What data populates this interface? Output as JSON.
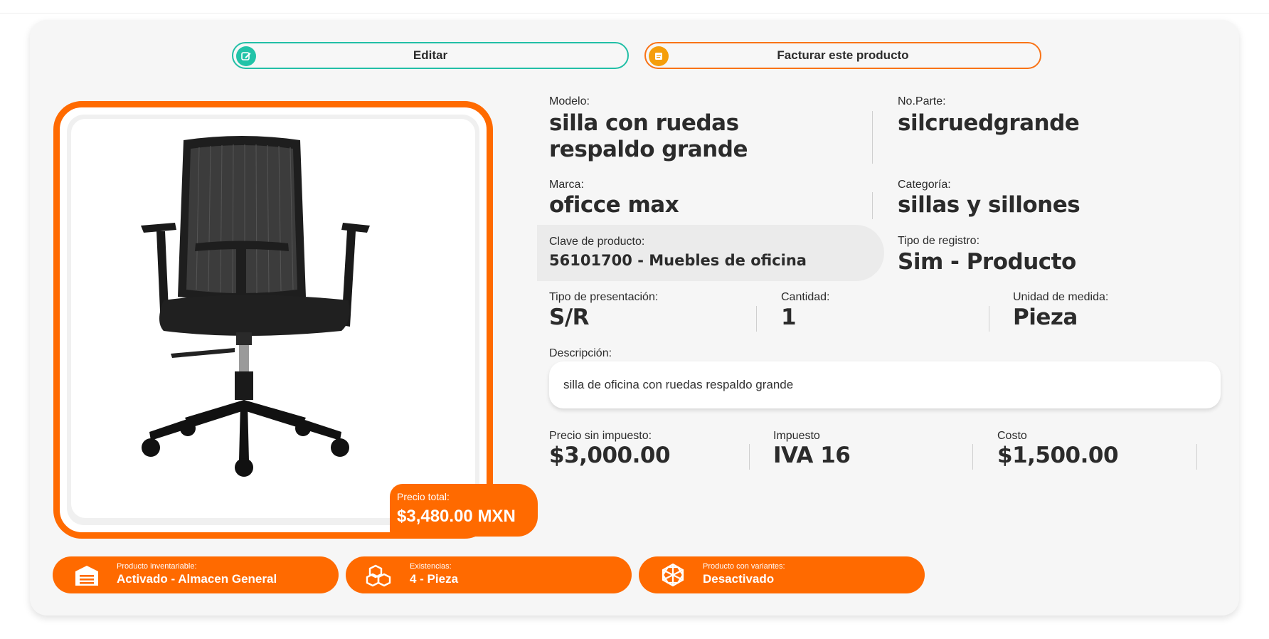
{
  "actions": {
    "edit_label": "Editar",
    "invoice_label": "Facturar este producto"
  },
  "product": {
    "modelo_label": "Modelo:",
    "modelo_value": "silla con ruedas respaldo grande",
    "no_parte_label": "No.Parte:",
    "no_parte_value": "silcruedgrande",
    "marca_label": "Marca:",
    "marca_value": "oficce max",
    "categoria_label": "Categoría:",
    "categoria_value": "sillas y sillones",
    "clave_label": "Clave de producto:",
    "clave_value": "56101700 - Muebles de oficina",
    "tipo_registro_label": "Tipo de registro:",
    "tipo_registro_value": "Sim - Producto",
    "presentacion_label": "Tipo de presentación:",
    "presentacion_value": "S/R",
    "cantidad_label": "Cantidad:",
    "cantidad_value": "1",
    "unidad_label": "Unidad de medida:",
    "unidad_value": "Pieza",
    "descripcion_label": "Descripción:",
    "descripcion_value": "silla de oficina con ruedas respaldo grande",
    "precio_label": "Precio sin impuesto:",
    "precio_value": "$3,000.00",
    "impuesto_label": "Impuesto",
    "impuesto_value": "IVA 16",
    "costo_label": "Costo",
    "costo_value": "$1,500.00"
  },
  "price_total": {
    "label": "Precio total:",
    "value": "$3,480.00 MXN"
  },
  "status_pills": [
    {
      "label": "Producto inventariable:",
      "value": "Activado - Almacen General",
      "icon": "warehouse-icon"
    },
    {
      "label": "Existencias:",
      "value": "4 - Pieza",
      "icon": "boxes-icon"
    },
    {
      "label": "Producto con variantes:",
      "value": "Desactivado",
      "icon": "variants-icon"
    }
  ],
  "colors": {
    "accent_orange": "#ff6a00",
    "edit_teal": "#22bfa6",
    "card_bg": "#f6f6f6"
  }
}
